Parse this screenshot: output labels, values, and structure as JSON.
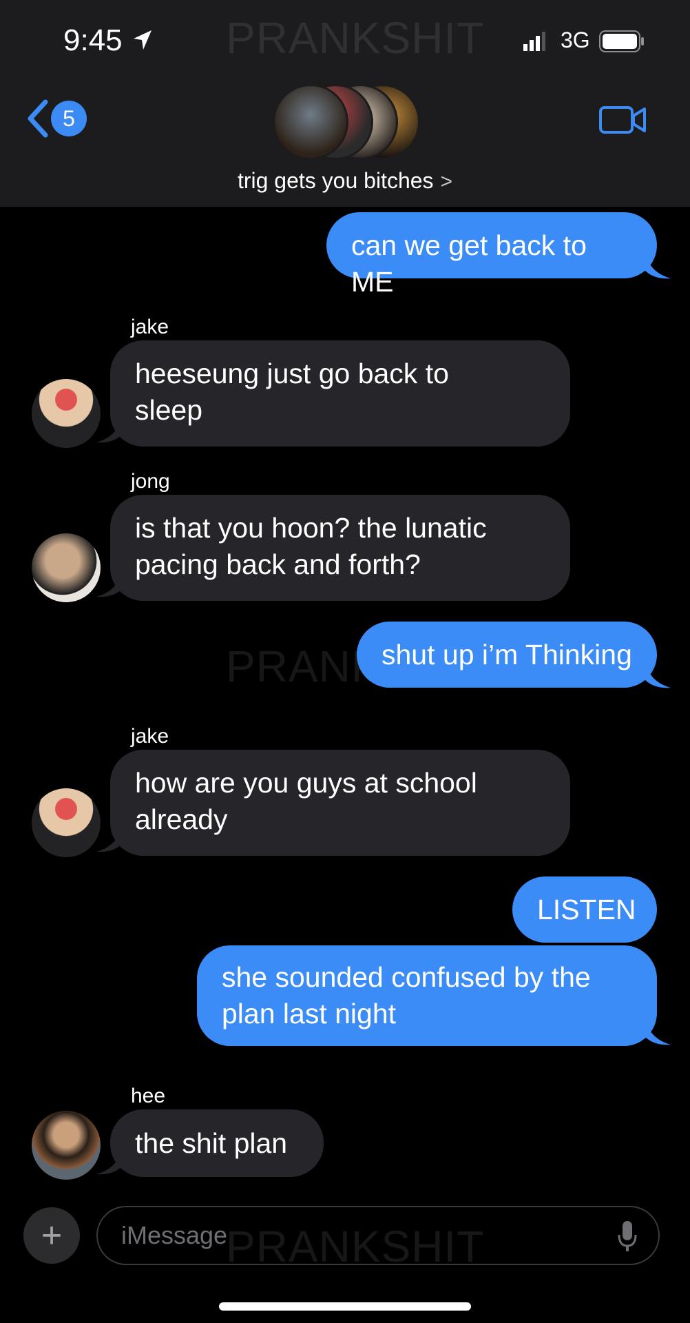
{
  "status_bar": {
    "time": "9:45",
    "network": "3G"
  },
  "watermark": "PRANKSHIT",
  "nav": {
    "back_count": "5",
    "title": "trig gets you bitches",
    "title_chevron": ">"
  },
  "messages": [
    {
      "direction": "out",
      "text": "can we get back to ME"
    },
    {
      "direction": "in",
      "sender": "jake",
      "lines": [
        "heeseung just go back to",
        "sleep"
      ]
    },
    {
      "direction": "in",
      "sender": "jong",
      "lines": [
        "is that you hoon? the lunatic",
        "pacing back and forth?"
      ]
    },
    {
      "direction": "out",
      "text": "shut up i’m Thinking"
    },
    {
      "direction": "in",
      "sender": "jake",
      "lines": [
        "how are you guys at school",
        "already"
      ]
    },
    {
      "direction": "out",
      "text": "LISTEN"
    },
    {
      "direction": "out",
      "lines": [
        "she sounded confused by the",
        "plan last night"
      ]
    },
    {
      "direction": "in",
      "sender": "hee",
      "text": "the shit plan"
    }
  ],
  "composer": {
    "placeholder": "iMessage",
    "plus": "+"
  },
  "colors": {
    "outgoing_bubble": "#3b8cf6",
    "incoming_bubble": "#26262a",
    "accent": "#3c8bf5",
    "header_bg": "#1c1c1e"
  }
}
